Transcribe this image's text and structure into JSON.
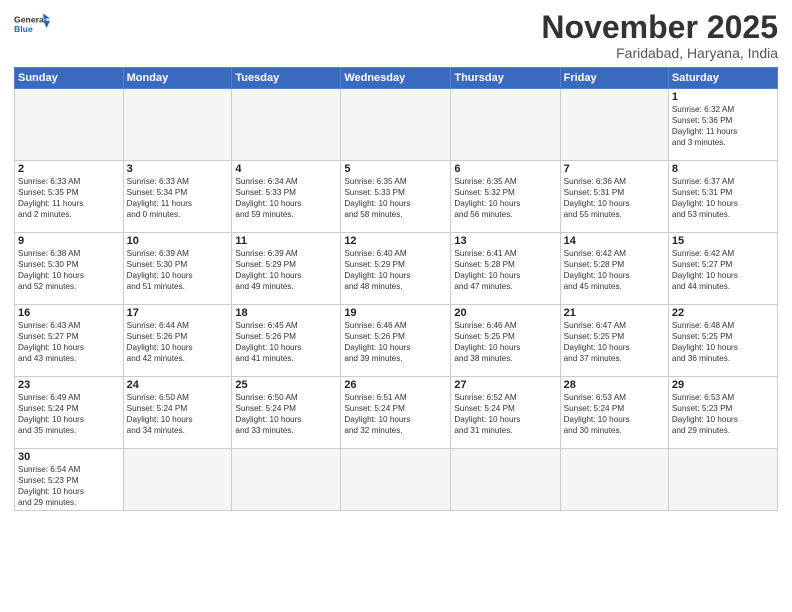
{
  "logo": {
    "general": "General",
    "blue": "Blue"
  },
  "title": "November 2025",
  "subtitle": "Faridabad, Haryana, India",
  "headers": [
    "Sunday",
    "Monday",
    "Tuesday",
    "Wednesday",
    "Thursday",
    "Friday",
    "Saturday"
  ],
  "weeks": [
    [
      {
        "day": "",
        "info": "",
        "empty": true
      },
      {
        "day": "",
        "info": "",
        "empty": true
      },
      {
        "day": "",
        "info": "",
        "empty": true
      },
      {
        "day": "",
        "info": "",
        "empty": true
      },
      {
        "day": "",
        "info": "",
        "empty": true
      },
      {
        "day": "",
        "info": "",
        "empty": true
      },
      {
        "day": "1",
        "info": "Sunrise: 6:32 AM\nSunset: 5:36 PM\nDaylight: 11 hours\nand 3 minutes."
      }
    ],
    [
      {
        "day": "2",
        "info": "Sunrise: 6:33 AM\nSunset: 5:35 PM\nDaylight: 11 hours\nand 2 minutes."
      },
      {
        "day": "3",
        "info": "Sunrise: 6:33 AM\nSunset: 5:34 PM\nDaylight: 11 hours\nand 0 minutes."
      },
      {
        "day": "4",
        "info": "Sunrise: 6:34 AM\nSunset: 5:33 PM\nDaylight: 10 hours\nand 59 minutes."
      },
      {
        "day": "5",
        "info": "Sunrise: 6:35 AM\nSunset: 5:33 PM\nDaylight: 10 hours\nand 58 minutes."
      },
      {
        "day": "6",
        "info": "Sunrise: 6:35 AM\nSunset: 5:32 PM\nDaylight: 10 hours\nand 56 minutes."
      },
      {
        "day": "7",
        "info": "Sunrise: 6:36 AM\nSunset: 5:31 PM\nDaylight: 10 hours\nand 55 minutes."
      },
      {
        "day": "8",
        "info": "Sunrise: 6:37 AM\nSunset: 5:31 PM\nDaylight: 10 hours\nand 53 minutes."
      }
    ],
    [
      {
        "day": "9",
        "info": "Sunrise: 6:38 AM\nSunset: 5:30 PM\nDaylight: 10 hours\nand 52 minutes."
      },
      {
        "day": "10",
        "info": "Sunrise: 6:39 AM\nSunset: 5:30 PM\nDaylight: 10 hours\nand 51 minutes."
      },
      {
        "day": "11",
        "info": "Sunrise: 6:39 AM\nSunset: 5:29 PM\nDaylight: 10 hours\nand 49 minutes."
      },
      {
        "day": "12",
        "info": "Sunrise: 6:40 AM\nSunset: 5:29 PM\nDaylight: 10 hours\nand 48 minutes."
      },
      {
        "day": "13",
        "info": "Sunrise: 6:41 AM\nSunset: 5:28 PM\nDaylight: 10 hours\nand 47 minutes."
      },
      {
        "day": "14",
        "info": "Sunrise: 6:42 AM\nSunset: 5:28 PM\nDaylight: 10 hours\nand 45 minutes."
      },
      {
        "day": "15",
        "info": "Sunrise: 6:42 AM\nSunset: 5:27 PM\nDaylight: 10 hours\nand 44 minutes."
      }
    ],
    [
      {
        "day": "16",
        "info": "Sunrise: 6:43 AM\nSunset: 5:27 PM\nDaylight: 10 hours\nand 43 minutes."
      },
      {
        "day": "17",
        "info": "Sunrise: 6:44 AM\nSunset: 5:26 PM\nDaylight: 10 hours\nand 42 minutes."
      },
      {
        "day": "18",
        "info": "Sunrise: 6:45 AM\nSunset: 5:26 PM\nDaylight: 10 hours\nand 41 minutes."
      },
      {
        "day": "19",
        "info": "Sunrise: 6:46 AM\nSunset: 5:26 PM\nDaylight: 10 hours\nand 39 minutes."
      },
      {
        "day": "20",
        "info": "Sunrise: 6:46 AM\nSunset: 5:25 PM\nDaylight: 10 hours\nand 38 minutes."
      },
      {
        "day": "21",
        "info": "Sunrise: 6:47 AM\nSunset: 5:25 PM\nDaylight: 10 hours\nand 37 minutes."
      },
      {
        "day": "22",
        "info": "Sunrise: 6:48 AM\nSunset: 5:25 PM\nDaylight: 10 hours\nand 36 minutes."
      }
    ],
    [
      {
        "day": "23",
        "info": "Sunrise: 6:49 AM\nSunset: 5:24 PM\nDaylight: 10 hours\nand 35 minutes."
      },
      {
        "day": "24",
        "info": "Sunrise: 6:50 AM\nSunset: 5:24 PM\nDaylight: 10 hours\nand 34 minutes."
      },
      {
        "day": "25",
        "info": "Sunrise: 6:50 AM\nSunset: 5:24 PM\nDaylight: 10 hours\nand 33 minutes."
      },
      {
        "day": "26",
        "info": "Sunrise: 6:51 AM\nSunset: 5:24 PM\nDaylight: 10 hours\nand 32 minutes."
      },
      {
        "day": "27",
        "info": "Sunrise: 6:52 AM\nSunset: 5:24 PM\nDaylight: 10 hours\nand 31 minutes."
      },
      {
        "day": "28",
        "info": "Sunrise: 6:53 AM\nSunset: 5:24 PM\nDaylight: 10 hours\nand 30 minutes."
      },
      {
        "day": "29",
        "info": "Sunrise: 6:53 AM\nSunset: 5:23 PM\nDaylight: 10 hours\nand 29 minutes."
      }
    ],
    [
      {
        "day": "30",
        "info": "Sunrise: 6:54 AM\nSunset: 5:23 PM\nDaylight: 10 hours\nand 29 minutes.",
        "last": true
      },
      {
        "day": "",
        "info": "",
        "empty": true,
        "last": true
      },
      {
        "day": "",
        "info": "",
        "empty": true,
        "last": true
      },
      {
        "day": "",
        "info": "",
        "empty": true,
        "last": true
      },
      {
        "day": "",
        "info": "",
        "empty": true,
        "last": true
      },
      {
        "day": "",
        "info": "",
        "empty": true,
        "last": true
      },
      {
        "day": "",
        "info": "",
        "empty": true,
        "last": true
      }
    ]
  ]
}
